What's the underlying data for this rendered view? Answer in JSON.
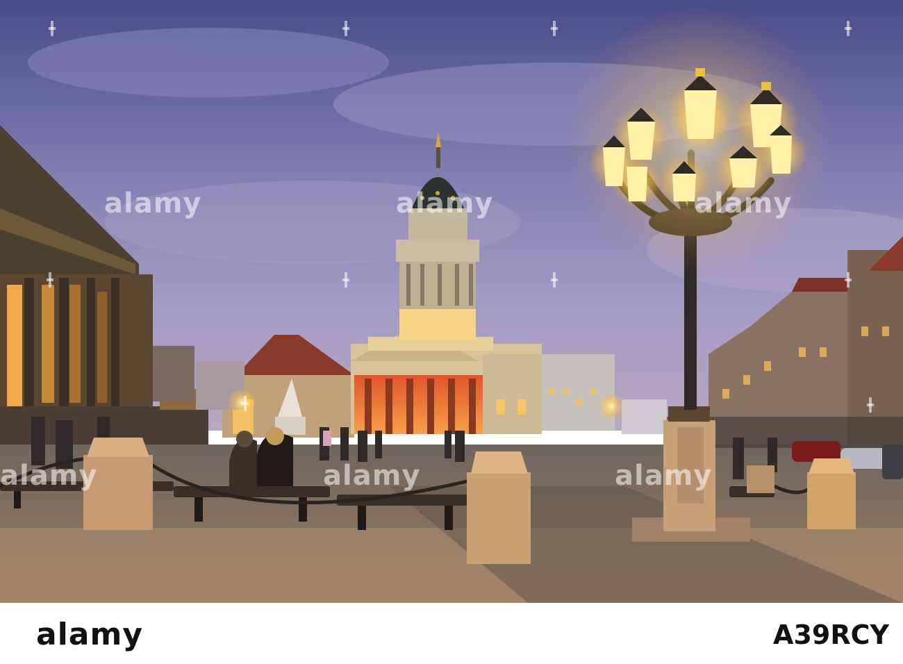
{
  "watermark": {
    "text": "alamy"
  },
  "footer": {
    "logo": "alamy",
    "image_id": "A39RCY"
  },
  "colors": {
    "sky_top": "#4b4d8a",
    "sky_mid": "#8b86b8",
    "lamp_glow": "#ffd45a",
    "pavement": "#7d6a5a"
  }
}
